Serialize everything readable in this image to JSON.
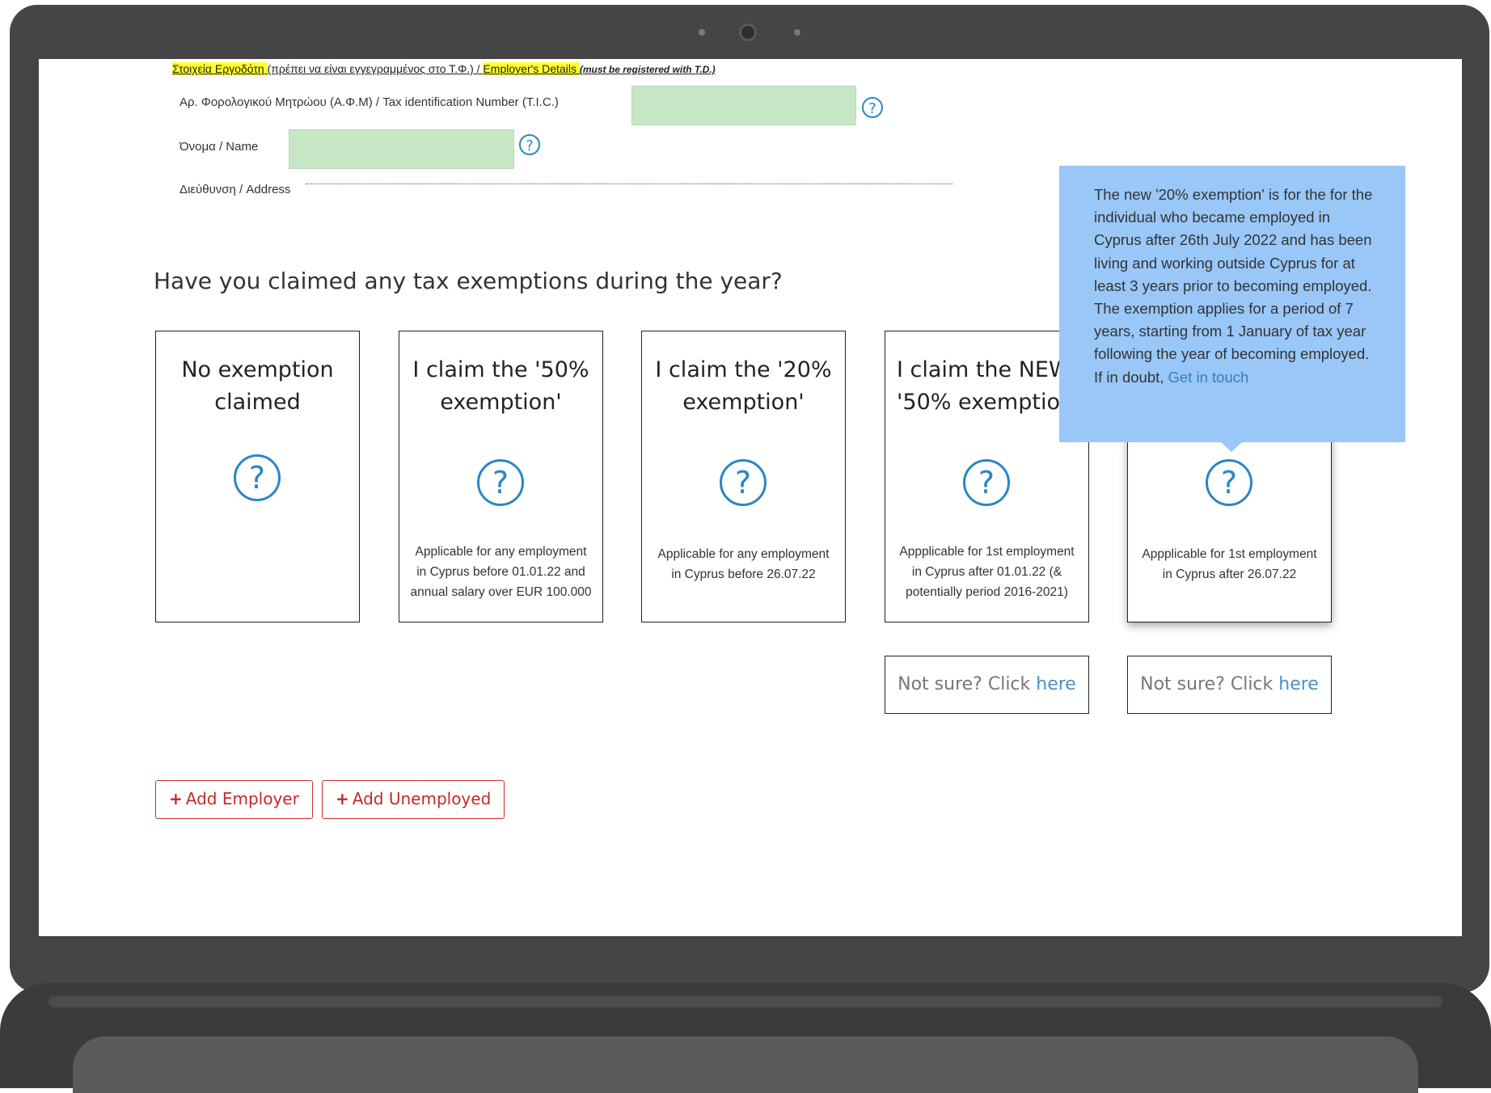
{
  "employer_section": {
    "heading_gr_1": "Στοιχεία Εργοδότη ",
    "heading_gr_2": "(πρέπει να είναι εγγεγραμμένος στο Τ.Φ.) / ",
    "heading_en": "Employer's Details ",
    "heading_note": "(must be registered with T.D.)",
    "tic_label": "Αρ. Φορολογικού Μητρώου (Α.Φ.Μ) / Tax identification Number (T.I.C.)",
    "tic_value": "",
    "name_label": "Όνομα / Name",
    "name_value": "",
    "address_label": "Διεύθυνση / Address"
  },
  "help_glyph": "?",
  "question": "Have you claimed any tax exemptions during the year?",
  "cards": [
    {
      "title": "No exemption\nclaimed",
      "description": ""
    },
    {
      "title": "I claim the '50%\nexemption'",
      "description": "Applicable for any employment\nin Cyprus before 01.01.22 and\nannual salary over EUR 100.000"
    },
    {
      "title": "I claim the '20%\nexemption'",
      "description": "Applicable for any employment\nin Cyprus before 26.07.22"
    },
    {
      "title": "I claim the NEW\n'50% exemption'",
      "description": "Appplicable for 1st employment\nin Cyprus after 01.01.22 (&\npotentially period 2016-2021)"
    },
    {
      "title": "",
      "description": "Appplicable for 1st employment\nin Cyprus after 26.07.22"
    }
  ],
  "not_sure": {
    "text": "Not sure? Click ",
    "link": "here"
  },
  "tooltip": {
    "text": "The new '20% exemption' is for the for the individual who became employed in Cyprus after 26th July 2022 and has been living and working outside Cyprus for at least 3 years prior to becoming employed. The exemption applies for a period of 7 years, starting from 1 January of tax year following the year of becoming employed. If in doubt, ",
    "link": "Get in touch"
  },
  "buttons": {
    "plus": "+",
    "add_employer": "Add Employer",
    "add_unemployed": "Add Unemployed"
  },
  "colors": {
    "accent": "#2b86c5",
    "input_bg": "#c6e6c6",
    "tooltip_bg": "#99c7f8",
    "button_red": "#c62828",
    "highlight": "#ffff33"
  }
}
